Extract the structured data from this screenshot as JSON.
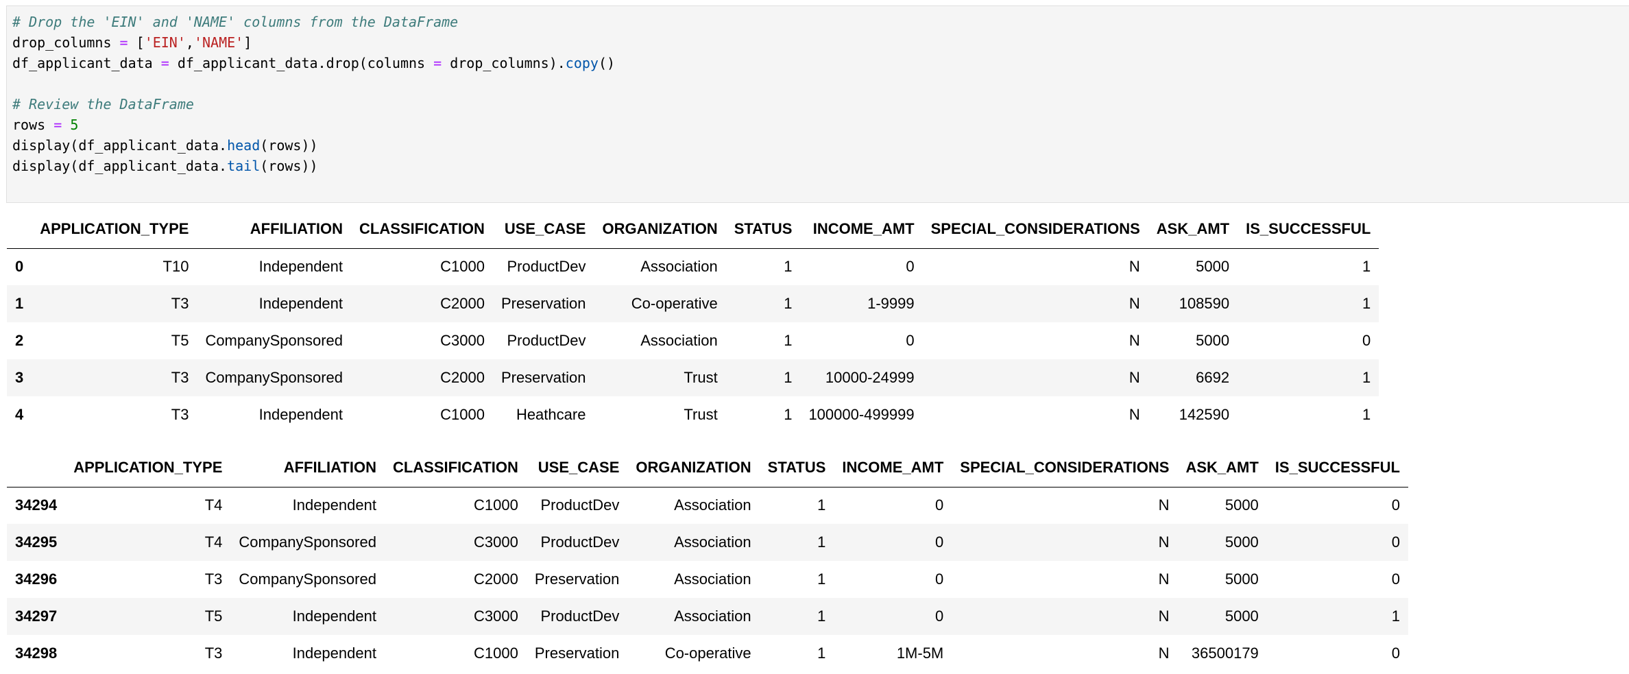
{
  "code_cell": {
    "lines": [
      {
        "parts": [
          {
            "cls": "cm-comment",
            "text": "# Drop the 'EIN' and 'NAME' columns from the DataFrame"
          }
        ]
      },
      {
        "parts": [
          {
            "cls": "cm-plain",
            "text": "drop_columns "
          },
          {
            "cls": "cm-op",
            "text": "="
          },
          {
            "cls": "cm-plain",
            "text": " ["
          },
          {
            "cls": "cm-string",
            "text": "'EIN'"
          },
          {
            "cls": "cm-plain",
            "text": ","
          },
          {
            "cls": "cm-string",
            "text": "'NAME'"
          },
          {
            "cls": "cm-plain",
            "text": "]"
          }
        ]
      },
      {
        "parts": [
          {
            "cls": "cm-plain",
            "text": "df_applicant_data "
          },
          {
            "cls": "cm-op",
            "text": "="
          },
          {
            "cls": "cm-plain",
            "text": " df_applicant_data.drop(columns "
          },
          {
            "cls": "cm-op",
            "text": "="
          },
          {
            "cls": "cm-plain",
            "text": " drop_columns)."
          },
          {
            "cls": "cm-attr",
            "text": "copy"
          },
          {
            "cls": "cm-plain",
            "text": "()"
          }
        ]
      },
      {
        "parts": [
          {
            "cls": "cm-plain",
            "text": ""
          }
        ]
      },
      {
        "parts": [
          {
            "cls": "cm-comment",
            "text": "# Review the DataFrame"
          }
        ]
      },
      {
        "parts": [
          {
            "cls": "cm-plain",
            "text": "rows "
          },
          {
            "cls": "cm-op",
            "text": "="
          },
          {
            "cls": "cm-plain",
            "text": " "
          },
          {
            "cls": "cm-num",
            "text": "5"
          }
        ]
      },
      {
        "parts": [
          {
            "cls": "cm-plain",
            "text": "display(df_applicant_data."
          },
          {
            "cls": "cm-attr",
            "text": "head"
          },
          {
            "cls": "cm-plain",
            "text": "(rows))"
          }
        ]
      },
      {
        "parts": [
          {
            "cls": "cm-plain",
            "text": "display(df_applicant_data."
          },
          {
            "cls": "cm-attr",
            "text": "tail"
          },
          {
            "cls": "cm-plain",
            "text": "(rows))"
          }
        ]
      }
    ]
  },
  "columns": [
    "",
    "APPLICATION_TYPE",
    "AFFILIATION",
    "CLASSIFICATION",
    "USE_CASE",
    "ORGANIZATION",
    "STATUS",
    "INCOME_AMT",
    "SPECIAL_CONSIDERATIONS",
    "ASK_AMT",
    "IS_SUCCESSFUL"
  ],
  "head_table": {
    "rows": [
      {
        "index": "0",
        "cells": [
          "T10",
          "Independent",
          "C1000",
          "ProductDev",
          "Association",
          "1",
          "0",
          "N",
          "5000",
          "1"
        ]
      },
      {
        "index": "1",
        "cells": [
          "T3",
          "Independent",
          "C2000",
          "Preservation",
          "Co-operative",
          "1",
          "1-9999",
          "N",
          "108590",
          "1"
        ]
      },
      {
        "index": "2",
        "cells": [
          "T5",
          "CompanySponsored",
          "C3000",
          "ProductDev",
          "Association",
          "1",
          "0",
          "N",
          "5000",
          "0"
        ]
      },
      {
        "index": "3",
        "cells": [
          "T3",
          "CompanySponsored",
          "C2000",
          "Preservation",
          "Trust",
          "1",
          "10000-24999",
          "N",
          "6692",
          "1"
        ]
      },
      {
        "index": "4",
        "cells": [
          "T3",
          "Independent",
          "C1000",
          "Heathcare",
          "Trust",
          "1",
          "100000-499999",
          "N",
          "142590",
          "1"
        ]
      }
    ]
  },
  "tail_table": {
    "rows": [
      {
        "index": "34294",
        "cells": [
          "T4",
          "Independent",
          "C1000",
          "ProductDev",
          "Association",
          "1",
          "0",
          "N",
          "5000",
          "0"
        ]
      },
      {
        "index": "34295",
        "cells": [
          "T4",
          "CompanySponsored",
          "C3000",
          "ProductDev",
          "Association",
          "1",
          "0",
          "N",
          "5000",
          "0"
        ]
      },
      {
        "index": "34296",
        "cells": [
          "T3",
          "CompanySponsored",
          "C2000",
          "Preservation",
          "Association",
          "1",
          "0",
          "N",
          "5000",
          "0"
        ]
      },
      {
        "index": "34297",
        "cells": [
          "T5",
          "Independent",
          "C3000",
          "ProductDev",
          "Association",
          "1",
          "0",
          "N",
          "5000",
          "1"
        ]
      },
      {
        "index": "34298",
        "cells": [
          "T3",
          "Independent",
          "C1000",
          "Preservation",
          "Co-operative",
          "1",
          "1M-5M",
          "N",
          "36500179",
          "0"
        ]
      }
    ]
  }
}
